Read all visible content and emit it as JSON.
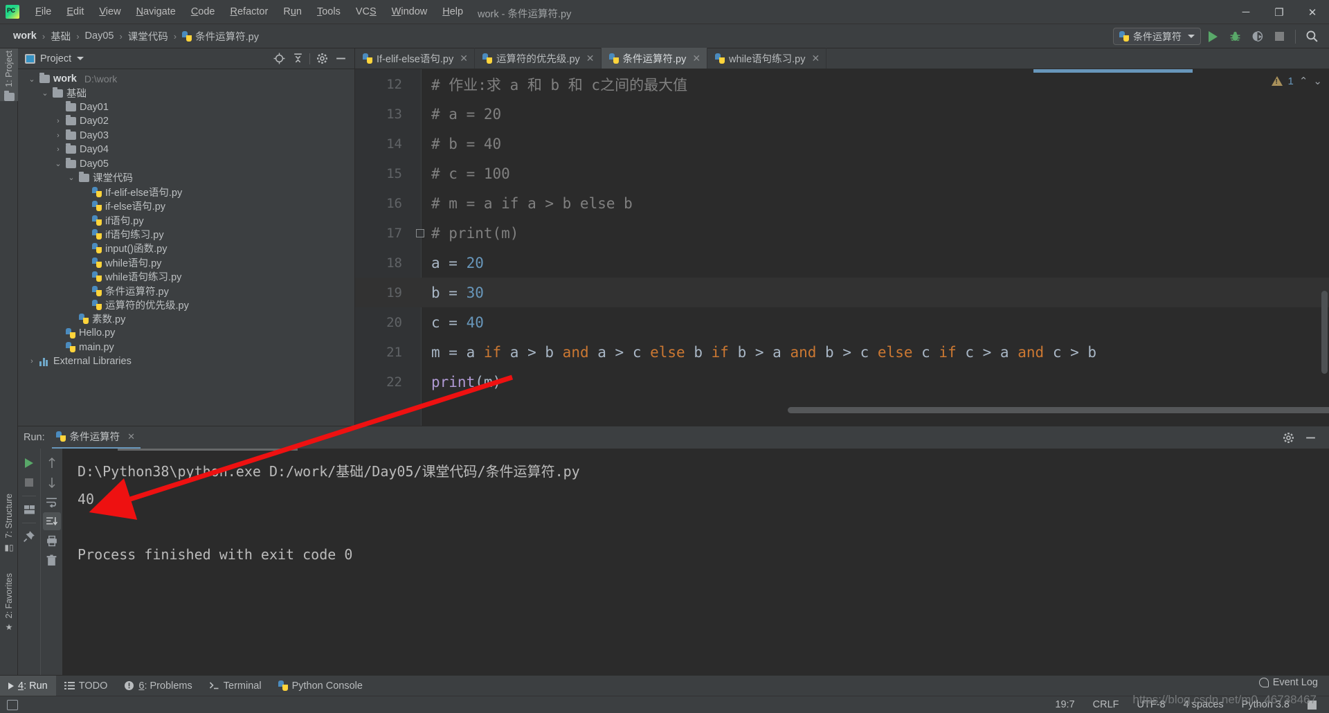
{
  "window": {
    "title": "work - 条件运算符.py",
    "logo_icon": "pycharm-logo-icon",
    "minimize_glyph": "─",
    "maximize_glyph": "❐",
    "close_glyph": "✕"
  },
  "menu": {
    "items": [
      {
        "label": "File"
      },
      {
        "label": "Edit"
      },
      {
        "label": "View"
      },
      {
        "label": "Navigate"
      },
      {
        "label": "Code"
      },
      {
        "label": "Refactor"
      },
      {
        "label": "Run"
      },
      {
        "label": "Tools"
      },
      {
        "label": "VCS"
      },
      {
        "label": "Window"
      },
      {
        "label": "Help"
      }
    ]
  },
  "breadcrumb": {
    "separator": "›",
    "items": [
      "work",
      "基础",
      "Day05",
      "课堂代码"
    ],
    "file": "条件运算符.py"
  },
  "toolbar": {
    "run_config": "条件运算符",
    "run_tooltip": "Run",
    "debug_tooltip": "Debug",
    "coverage_tooltip": "Run with Coverage",
    "stop_tooltip": "Stop",
    "search_tooltip": "Search Everywhere"
  },
  "rail": {
    "project": "1: Project",
    "structure": "7: Structure",
    "favorites": "2: Favorites"
  },
  "project_panel": {
    "title": "Project",
    "tools": [
      "locate-icon",
      "collapse-all-icon",
      "settings-icon",
      "hide-icon"
    ],
    "tree": [
      {
        "depth": 0,
        "arrow": "down",
        "type": "folder",
        "name": "work",
        "bold": true,
        "path": "D:\\work"
      },
      {
        "depth": 1,
        "arrow": "down",
        "type": "folder",
        "name": "基础",
        "bold": false,
        "path": ""
      },
      {
        "depth": 2,
        "arrow": "none",
        "type": "folder",
        "name": "Day01",
        "bold": false,
        "path": ""
      },
      {
        "depth": 2,
        "arrow": "right",
        "type": "folder",
        "name": "Day02",
        "bold": false,
        "path": ""
      },
      {
        "depth": 2,
        "arrow": "right",
        "type": "folder",
        "name": "Day03",
        "bold": false,
        "path": ""
      },
      {
        "depth": 2,
        "arrow": "right",
        "type": "folder",
        "name": "Day04",
        "bold": false,
        "path": ""
      },
      {
        "depth": 2,
        "arrow": "down",
        "type": "folder",
        "name": "Day05",
        "bold": false,
        "path": ""
      },
      {
        "depth": 3,
        "arrow": "down",
        "type": "folder",
        "name": "课堂代码",
        "bold": false,
        "path": ""
      },
      {
        "depth": 4,
        "arrow": "none",
        "type": "python",
        "name": "If-elif-else语句.py",
        "bold": false,
        "path": ""
      },
      {
        "depth": 4,
        "arrow": "none",
        "type": "python",
        "name": "if-else语句.py",
        "bold": false,
        "path": ""
      },
      {
        "depth": 4,
        "arrow": "none",
        "type": "python",
        "name": "if语句.py",
        "bold": false,
        "path": ""
      },
      {
        "depth": 4,
        "arrow": "none",
        "type": "python",
        "name": "if语句练习.py",
        "bold": false,
        "path": ""
      },
      {
        "depth": 4,
        "arrow": "none",
        "type": "python",
        "name": "input()函数.py",
        "bold": false,
        "path": ""
      },
      {
        "depth": 4,
        "arrow": "none",
        "type": "python",
        "name": "while语句.py",
        "bold": false,
        "path": ""
      },
      {
        "depth": 4,
        "arrow": "none",
        "type": "python",
        "name": "while语句练习.py",
        "bold": false,
        "path": ""
      },
      {
        "depth": 4,
        "arrow": "none",
        "type": "python",
        "name": "条件运算符.py",
        "bold": false,
        "path": ""
      },
      {
        "depth": 4,
        "arrow": "none",
        "type": "python",
        "name": "运算符的优先级.py",
        "bold": false,
        "path": ""
      },
      {
        "depth": 3,
        "arrow": "none",
        "type": "python",
        "name": "素数.py",
        "bold": false,
        "path": ""
      },
      {
        "depth": 2,
        "arrow": "none",
        "type": "python",
        "name": "Hello.py",
        "bold": false,
        "path": ""
      },
      {
        "depth": 2,
        "arrow": "none",
        "type": "python",
        "name": "main.py",
        "bold": false,
        "path": ""
      },
      {
        "depth": 0,
        "arrow": "right",
        "type": "library",
        "name": "External Libraries",
        "bold": false,
        "path": ""
      }
    ]
  },
  "editor": {
    "tabs": [
      {
        "label": "If-elif-else语句.py",
        "active": false
      },
      {
        "label": "运算符的优先级.py",
        "active": false
      },
      {
        "label": "条件运算符.py",
        "active": true
      },
      {
        "label": "while语句练习.py",
        "active": false
      }
    ],
    "close_glyph": "✕",
    "warning_count": "1",
    "warning_up": "⌃",
    "warning_down": "⌄",
    "lines": [
      {
        "num": "12",
        "current": false,
        "fold": false,
        "parts": [
          {
            "t": "# 作业:求 a 和 b 和 c之间的最大值",
            "c": "cmt"
          }
        ]
      },
      {
        "num": "13",
        "current": false,
        "fold": false,
        "parts": [
          {
            "t": "# a = 20",
            "c": "cmt"
          }
        ]
      },
      {
        "num": "14",
        "current": false,
        "fold": false,
        "parts": [
          {
            "t": "# b = 40",
            "c": "cmt"
          }
        ]
      },
      {
        "num": "15",
        "current": false,
        "fold": false,
        "parts": [
          {
            "t": "# c = 100",
            "c": "cmt"
          }
        ]
      },
      {
        "num": "16",
        "current": false,
        "fold": false,
        "parts": [
          {
            "t": "# m = a if a > b else b",
            "c": "cmt"
          }
        ]
      },
      {
        "num": "17",
        "current": false,
        "fold": true,
        "parts": [
          {
            "t": "# print(m)",
            "c": "cmt"
          }
        ]
      },
      {
        "num": "18",
        "current": false,
        "fold": false,
        "parts": [
          {
            "t": "a = ",
            "c": "pl"
          },
          {
            "t": "20",
            "c": "num"
          }
        ]
      },
      {
        "num": "19",
        "current": true,
        "fold": false,
        "parts": [
          {
            "t": "b = ",
            "c": "pl"
          },
          {
            "t": "30",
            "c": "num"
          }
        ]
      },
      {
        "num": "20",
        "current": false,
        "fold": false,
        "parts": [
          {
            "t": "c = ",
            "c": "pl"
          },
          {
            "t": "40",
            "c": "num"
          }
        ]
      },
      {
        "num": "21",
        "current": false,
        "fold": false,
        "parts": [
          {
            "t": "m = a ",
            "c": "pl"
          },
          {
            "t": "if",
            "c": "kw"
          },
          {
            "t": " a > b ",
            "c": "pl"
          },
          {
            "t": "and",
            "c": "kw"
          },
          {
            "t": " a > c ",
            "c": "pl"
          },
          {
            "t": "else",
            "c": "kw"
          },
          {
            "t": " b ",
            "c": "pl"
          },
          {
            "t": "if",
            "c": "kw"
          },
          {
            "t": " b > a ",
            "c": "pl"
          },
          {
            "t": "and",
            "c": "kw"
          },
          {
            "t": " b > c ",
            "c": "pl"
          },
          {
            "t": "else",
            "c": "kw"
          },
          {
            "t": " c ",
            "c": "pl"
          },
          {
            "t": "if",
            "c": "kw"
          },
          {
            "t": " c > a ",
            "c": "pl"
          },
          {
            "t": "and",
            "c": "kw"
          },
          {
            "t": " c > b",
            "c": "pl"
          }
        ]
      },
      {
        "num": "22",
        "current": false,
        "fold": false,
        "parts": [
          {
            "t": "print",
            "c": "fn"
          },
          {
            "t": "(m)",
            "c": "pl"
          }
        ]
      }
    ]
  },
  "run_panel": {
    "label": "Run:",
    "tab_name": "条件运算符",
    "close_glyph": "✕",
    "settings_icon": "gear-icon",
    "hide_icon": "hide-icon",
    "side_tools": [
      "rerun-icon",
      "stop-icon",
      "layout-icon",
      "pin-icon"
    ],
    "side_tools2": [
      "scroll-up-icon",
      "scroll-down-icon",
      "soft-wrap-icon",
      "scroll-to-end-icon",
      "print-icon",
      "clear-all-icon"
    ],
    "console": [
      "D:\\Python38\\python.exe D:/work/基础/Day05/课堂代码/条件运算符.py",
      "40",
      "",
      "Process finished with exit code 0"
    ]
  },
  "status_bar": {
    "tabs": [
      {
        "label": "4: Run",
        "icon": "run-icon",
        "active": true
      },
      {
        "label": "TODO",
        "icon": "todo-icon",
        "active": false
      },
      {
        "label": "6: Problems",
        "icon": "problems-icon",
        "active": false
      },
      {
        "label": "Terminal",
        "icon": "terminal-icon",
        "active": false
      },
      {
        "label": "Python Console",
        "icon": "python-icon",
        "active": false
      }
    ],
    "event_log": "Event Log",
    "caret": "19:7",
    "line_sep": "CRLF",
    "encoding": "UTF-8",
    "indent": "4 spaces",
    "interpreter": "Python 3.8",
    "watermark": "https://blog.csdn.net/m0_46738467"
  },
  "colors": {
    "accent_blue": "#6897bb",
    "keyword_orange": "#cc7832",
    "function_purple": "#b09ad4",
    "comment_gray": "#808080",
    "run_green": "#59a869",
    "annotation_red": "#ee1111"
  }
}
